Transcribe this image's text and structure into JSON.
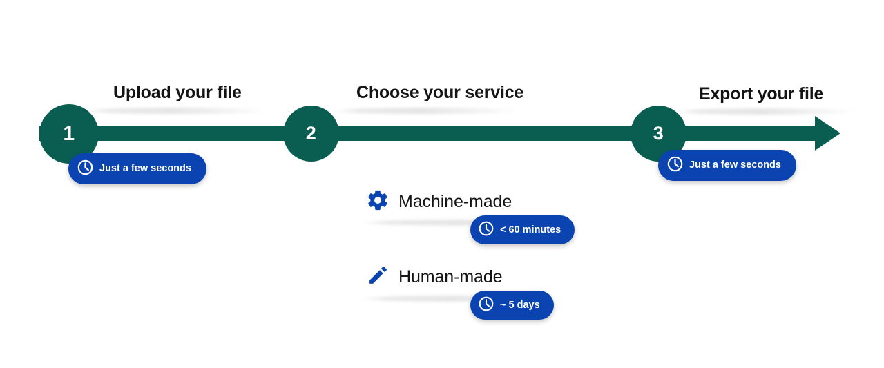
{
  "colors": {
    "green": "#0a5e51",
    "blue": "#0b44b0",
    "text": "#141414",
    "background": "#ffffff"
  },
  "steps": [
    {
      "number": "1",
      "title": "Upload your file",
      "duration": "Just a few seconds",
      "duration_icon": "clock-icon"
    },
    {
      "number": "2",
      "title": "Choose your service",
      "duration": null,
      "duration_icon": null
    },
    {
      "number": "3",
      "title": "Export your file",
      "duration": "Just a few seconds",
      "duration_icon": "clock-icon"
    }
  ],
  "services": [
    {
      "label": "Machine-made",
      "icon": "gear-icon",
      "duration": "< 60 minutes",
      "duration_icon": "clock-icon"
    },
    {
      "label": "Human-made",
      "icon": "pencil-icon",
      "duration": "~ 5 days",
      "duration_icon": "clock-icon"
    }
  ],
  "timeline": {
    "direction_icon": "arrow-right-icon"
  }
}
